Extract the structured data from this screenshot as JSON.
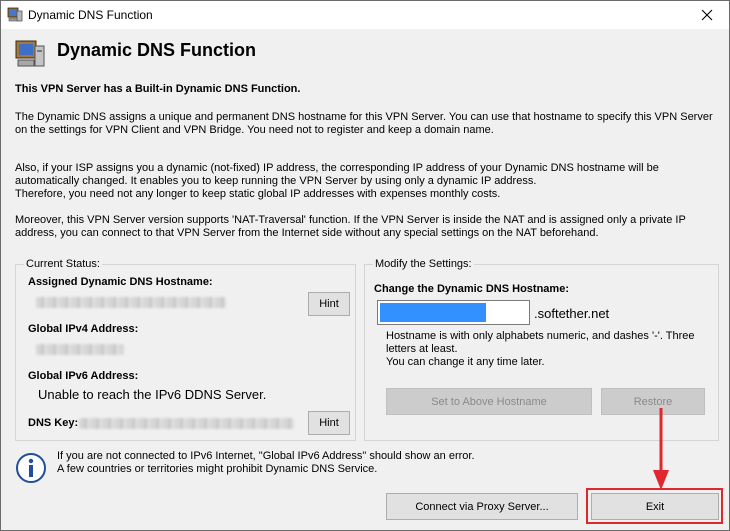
{
  "window": {
    "title": "Dynamic DNS Function",
    "close_icon": "close-icon"
  },
  "header": {
    "title": "Dynamic DNS Function",
    "icon": "computer-icon"
  },
  "intro": {
    "heading": "This VPN Server has a Built-in Dynamic DNS Function.",
    "p1_line1": "The Dynamic DNS assigns a unique and permanent DNS hostname for this VPN Server. You can use that hostname to specify this VPN Server",
    "p1_line2": "on the settings for VPN Client and VPN Bridge. You need not to register and keep a domain name.",
    "p2_line1": "Also, if your ISP assigns you a dynamic (not-fixed) IP address, the corresponding IP address of your Dynamic DNS hostname will be",
    "p2_line2": "automatically changed. It enables you to keep running the VPN Server by using only a dynamic IP address.",
    "p2_line3": "Therefore, you need not any longer to keep static global IP addresses with expenses monthly costs.",
    "p3_line1": "Moreover, this VPN Server version supports 'NAT-Traversal' function. If the VPN Server is inside the NAT and is assigned only a private IP",
    "p3_line2": "address, you can connect to that VPN Server from the Internet side without any special settings on the NAT beforehand."
  },
  "current_status": {
    "group_label": "Current Status:",
    "hostname_label": "Assigned Dynamic DNS Hostname:",
    "hint_label": "Hint",
    "ipv4_label": "Global IPv4 Address:",
    "ipv6_label": "Global IPv6 Address:",
    "ipv6_value": "Unable to reach the IPv6 DDNS Server.",
    "dns_key_label": "DNS Key:",
    "hint2_label": "Hint"
  },
  "modify": {
    "group_label": "Modify the Settings:",
    "change_label": "Change the Dynamic DNS Hostname:",
    "suffix": ".softether.net",
    "note_line1": "Hostname is with only alphabets numeric, and dashes '-'. Three",
    "note_line2": "letters at least.",
    "note_line3": "You can change it any time later.",
    "set_button": "Set to Above Hostname",
    "restore_button": "Restore"
  },
  "footer": {
    "info_line1": "If you are not connected to IPv6 Internet, \"Global IPv6 Address\" should show an error.",
    "info_line2": "A few countries or territories might prohibit Dynamic DNS Service.",
    "proxy_button": "Connect via Proxy Server...",
    "exit_button": "Exit"
  },
  "colors": {
    "annotation": "#e0262e",
    "selection": "#3390ff"
  }
}
